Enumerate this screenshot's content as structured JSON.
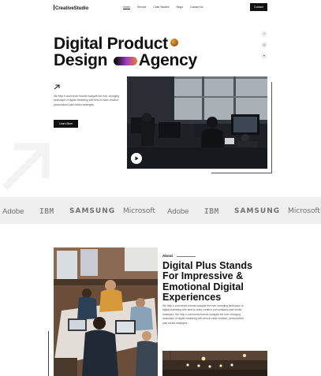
{
  "nav": {
    "logo": "CreativeStudio",
    "items": [
      "Home",
      "Service",
      "Case Studies",
      "Blogs",
      "Contact Us"
    ],
    "active_index": 0,
    "cta": "Contact"
  },
  "hero": {
    "title_line1": "Digital Product",
    "title_line2a": "Design",
    "title_line2b": "Agency",
    "paragraph": "We help e-commerce brands navigate the ever-changing landscape of digital marketing with best-in-class creative, personalized paid media strategies.",
    "cta": "Learn More"
  },
  "socials": {
    "items": [
      "f",
      "◎",
      "✦"
    ],
    "icons": [
      "facebook-icon",
      "instagram-icon",
      "twitter-icon"
    ]
  },
  "logos": [
    "Adobe",
    "IBM",
    "SAMSUNG",
    "Microsoft",
    "Adobe",
    "IBM",
    "SAMSUNG",
    "Microsoft"
  ],
  "about": {
    "label": "About",
    "title_lines": [
      "Digital Plus Stands",
      "For Impressive &",
      "Emotional Digital",
      "Experiences"
    ],
    "paragraph": "We help e-commerce brands navigate the ever-changing landscape of digital marketing with best-in-class creative, personalized paid media strategies. We help e-commerce brands navigate the ever changing landscape of digital marketing with best-in-class creative, personalized paid media strategies."
  },
  "colors": {
    "primary": "#111111",
    "logo_strip_bg": "#efefef",
    "accent_purple": "#a23cc8",
    "accent_orange": "#f07c2a"
  }
}
